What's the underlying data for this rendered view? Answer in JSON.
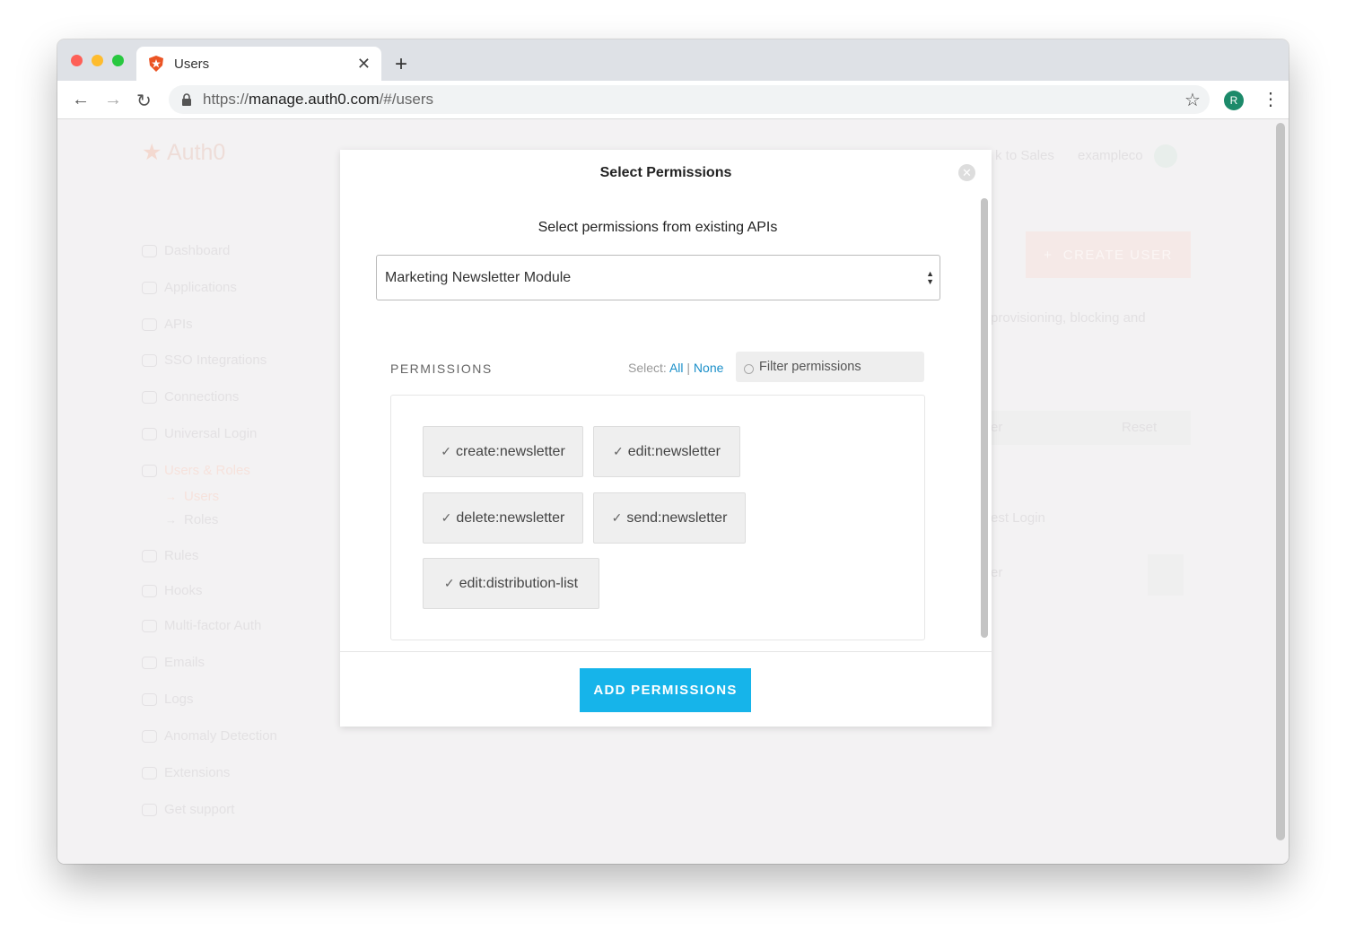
{
  "browser": {
    "tab_title": "Users",
    "url_prefix": "https://",
    "url_host": "manage.auth0.com",
    "url_path": "/#/users",
    "profile_initial": "R"
  },
  "background": {
    "logo_text": "Auth0",
    "sidebar": [
      "Dashboard",
      "Applications",
      "APIs",
      "SSO Integrations",
      "Connections",
      "Universal Login",
      "Users & Roles",
      "Users",
      "Roles",
      "Rules",
      "Hooks",
      "Multi-factor Auth",
      "Emails",
      "Logs",
      "Anomaly Detection",
      "Extensions",
      "Get support"
    ],
    "topbar_link": "k to Sales",
    "tenant": "exampleco",
    "create_user": "CREATE USER",
    "description": "provisioning, blocking and",
    "reset": "Reset",
    "filter_partial": "er",
    "column_partial": "est Login",
    "row_partial": "er"
  },
  "modal": {
    "title": "Select Permissions",
    "subtitle": "Select permissions from existing APIs",
    "api_select": "Marketing Newsletter Module",
    "permissions_label": "PERMISSIONS",
    "select_label": "Select:",
    "select_all": "All",
    "separator": "|",
    "select_none": "None",
    "filter_placeholder": "Filter permissions",
    "permissions": [
      "create:newsletter",
      "edit:newsletter",
      "delete:newsletter",
      "send:newsletter",
      "edit:distribution-list"
    ],
    "add_button": "ADD PERMISSIONS"
  },
  "colors": {
    "accent": "#16b4ea",
    "link": "#1a8fc9",
    "brand": "#eb5424"
  }
}
